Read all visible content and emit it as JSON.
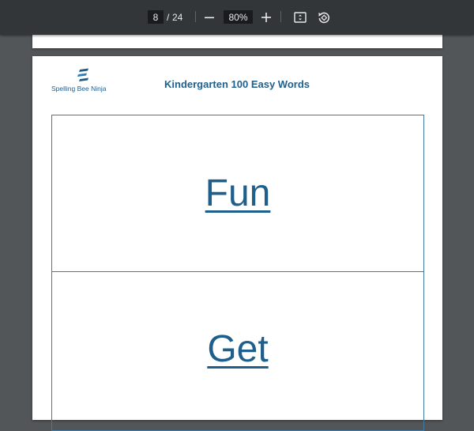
{
  "toolbar": {
    "current_page": "8",
    "page_separator": "/",
    "total_pages": "24",
    "zoom": "80%",
    "icons": {
      "zoom_out": "minus-icon",
      "zoom_in": "plus-icon",
      "fit": "fit-to-page-icon",
      "rotate": "rotate-counterclockwise-icon"
    }
  },
  "document": {
    "logo_text": "Spelling Bee Ninja",
    "title": "Kindergarten 100 Easy Words",
    "cards": [
      {
        "word": "Fun"
      },
      {
        "word": "Get"
      }
    ]
  },
  "colors": {
    "toolbar_bg": "#323639",
    "viewer_bg": "#525659",
    "brand_blue": "#1f5f8b",
    "card_border": "#3f7aa6"
  }
}
